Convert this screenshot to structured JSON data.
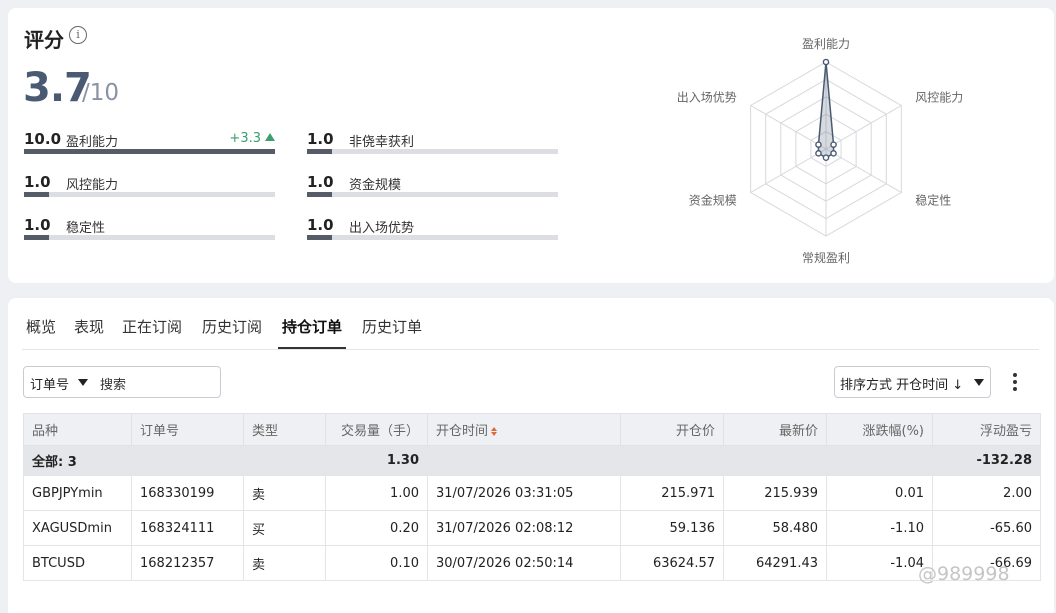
{
  "score": {
    "title": "评分",
    "value": "3.7",
    "max": "/10",
    "metrics": [
      {
        "value": "10.0",
        "label": "盈利能力",
        "delta": "+3.3",
        "ratio": 1.0
      },
      {
        "value": "1.0",
        "label": "非侥幸获利",
        "delta": "",
        "ratio": 0.1
      },
      {
        "value": "1.0",
        "label": "风控能力",
        "delta": "",
        "ratio": 0.1
      },
      {
        "value": "1.0",
        "label": "资金规模",
        "delta": "",
        "ratio": 0.1
      },
      {
        "value": "1.0",
        "label": "稳定性",
        "delta": "",
        "ratio": 0.1
      },
      {
        "value": "1.0",
        "label": "出入场优势",
        "delta": "",
        "ratio": 0.1
      }
    ]
  },
  "radar": {
    "axes": [
      "盈利能力",
      "风控能力",
      "稳定性",
      "常规盈利",
      "资金规模",
      "出入场优势"
    ],
    "values": [
      10,
      1,
      1,
      1,
      1,
      1
    ],
    "max": 10,
    "accent": "#4a5a73"
  },
  "tabs": [
    {
      "label": "概览",
      "active": false
    },
    {
      "label": "表现",
      "active": false
    },
    {
      "label": "正在订阅",
      "active": false
    },
    {
      "label": "历史订阅",
      "active": false
    },
    {
      "label": "持仓订单",
      "active": true
    },
    {
      "label": "历史订单",
      "active": false
    }
  ],
  "filter": {
    "select_label": "订单号",
    "search_placeholder": "搜索"
  },
  "sort": {
    "label": "排序方式 开仓时间 ↓"
  },
  "table": {
    "headers": [
      "品种",
      "订单号",
      "类型",
      "交易量（手）",
      "开仓时间",
      "开仓价",
      "最新价",
      "涨跌幅(%)",
      "浮动盈亏"
    ],
    "total": {
      "label": "全部: 3",
      "volume": "1.30",
      "pnl": "-132.28"
    },
    "rows": [
      {
        "symbol": "GBPJPYmin",
        "order": "168330199",
        "type": "卖",
        "volume": "1.00",
        "time": "31/07/2026 03:31:05",
        "open": "215.971",
        "last": "215.939",
        "change": "0.01",
        "pnl": "2.00",
        "sign": "pos"
      },
      {
        "symbol": "XAGUSDmin",
        "order": "168324111",
        "type": "买",
        "volume": "0.20",
        "time": "31/07/2026 02:08:12",
        "open": "59.136",
        "last": "58.480",
        "change": "-1.10",
        "pnl": "-65.60",
        "sign": "neg"
      },
      {
        "symbol": "BTCUSD",
        "order": "168212357",
        "type": "卖",
        "volume": "0.10",
        "time": "30/07/2026 02:50:14",
        "open": "63624.57",
        "last": "64291.43",
        "change": "-1.04",
        "pnl": "-66.69",
        "sign": "neg"
      }
    ]
  },
  "watermark": "@989998",
  "colors": {
    "positive": "#3a9e6e",
    "negative": "#d0444f"
  }
}
